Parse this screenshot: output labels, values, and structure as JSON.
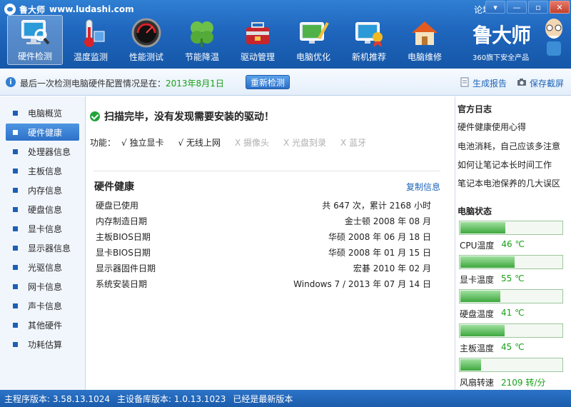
{
  "titlebar": {
    "app_name": "鲁大师",
    "url": "www.ludashi.com",
    "forum": "论坛",
    "min_symbol": "—",
    "max_symbol": "▫",
    "close_symbol": "✕",
    "menu_symbol": "▾"
  },
  "nav": [
    {
      "label": "硬件检测",
      "icon": "monitor-magnifier-icon"
    },
    {
      "label": "温度监测",
      "icon": "thermometer-icon"
    },
    {
      "label": "性能测试",
      "icon": "speedometer-icon"
    },
    {
      "label": "节能降温",
      "icon": "clover-icon"
    },
    {
      "label": "驱动管理",
      "icon": "toolbox-icon"
    },
    {
      "label": "电脑优化",
      "icon": "monitor-brush-icon"
    },
    {
      "label": "新机推荐",
      "icon": "monitor-badge-icon"
    },
    {
      "label": "电脑维修",
      "icon": "house-icon"
    }
  ],
  "brand": {
    "logo_text": "鲁大师",
    "subtitle": "360旗下安全产品"
  },
  "status": {
    "prefix": "最后一次检测电脑硬件配置情况是在：",
    "date": "2013年8月1日",
    "recheck": "重新检测",
    "report": "生成报告",
    "save_shot": "保存截屏"
  },
  "sidebar": [
    {
      "label": "电脑概览"
    },
    {
      "label": "硬件健康",
      "active": true
    },
    {
      "label": "处理器信息"
    },
    {
      "label": "主板信息"
    },
    {
      "label": "内存信息"
    },
    {
      "label": "硬盘信息"
    },
    {
      "label": "显卡信息"
    },
    {
      "label": "显示器信息"
    },
    {
      "label": "光驱信息"
    },
    {
      "label": "网卡信息"
    },
    {
      "label": "声卡信息"
    },
    {
      "label": "其他硬件"
    },
    {
      "label": "功耗估算"
    }
  ],
  "main": {
    "scan_message": "扫描完毕，没有发现需要安装的驱动！",
    "features_label": "功能：",
    "features": [
      {
        "label": "√ 独立显卡",
        "enabled": true
      },
      {
        "label": "√ 无线上网",
        "enabled": true
      },
      {
        "label": "X 摄像头",
        "enabled": false
      },
      {
        "label": "X 光盘刻录",
        "enabled": false
      },
      {
        "label": "X 蓝牙",
        "enabled": false
      }
    ],
    "section_title": "硬件健康",
    "copy_info": "复制信息",
    "rows": [
      {
        "label": "硬盘已使用",
        "value": "共 647 次，累计 2168 小时"
      },
      {
        "label": "内存制造日期",
        "value": "金士顿 2008 年 08 月"
      },
      {
        "label": "主板BIOS日期",
        "value": "华硕 2008 年 06 月 18 日"
      },
      {
        "label": "显卡BIOS日期",
        "value": "华硕 2008 年 01 月 15 日"
      },
      {
        "label": "显示器固件日期",
        "value": "宏碁 2010 年 02 月"
      },
      {
        "label": "系统安装日期",
        "value": "Windows 7 / 2013 年 07 月 14 日"
      }
    ]
  },
  "rightpanel": {
    "log_title": "官方日志",
    "logs": [
      "硬件健康使用心得",
      "电池消耗，自己应该多注意",
      "如何让笔记本长时间工作",
      "笔记本电池保养的几大误区"
    ],
    "state_title": "电脑状态",
    "gauges": [
      {
        "label": "CPU温度",
        "value": "46 ℃",
        "level": 0.44
      },
      {
        "label": "显卡温度",
        "value": "55 ℃",
        "level": 0.53
      },
      {
        "label": "硬盘温度",
        "value": "41 ℃",
        "level": 0.39
      },
      {
        "label": "主板温度",
        "value": "45 ℃",
        "level": 0.43
      },
      {
        "label": "风扇转速",
        "value": "2109 转/分",
        "level": 0.2
      }
    ]
  },
  "footer": {
    "main_version": "主程序版本: 3.58.13.1024",
    "db_version": "主设备库版本: 1.0.13.1023",
    "update_status": "已经是最新版本"
  },
  "colors": {
    "accent": "#1f66bd",
    "ok_green": "#18a018",
    "link_blue": "#1d63b8"
  }
}
